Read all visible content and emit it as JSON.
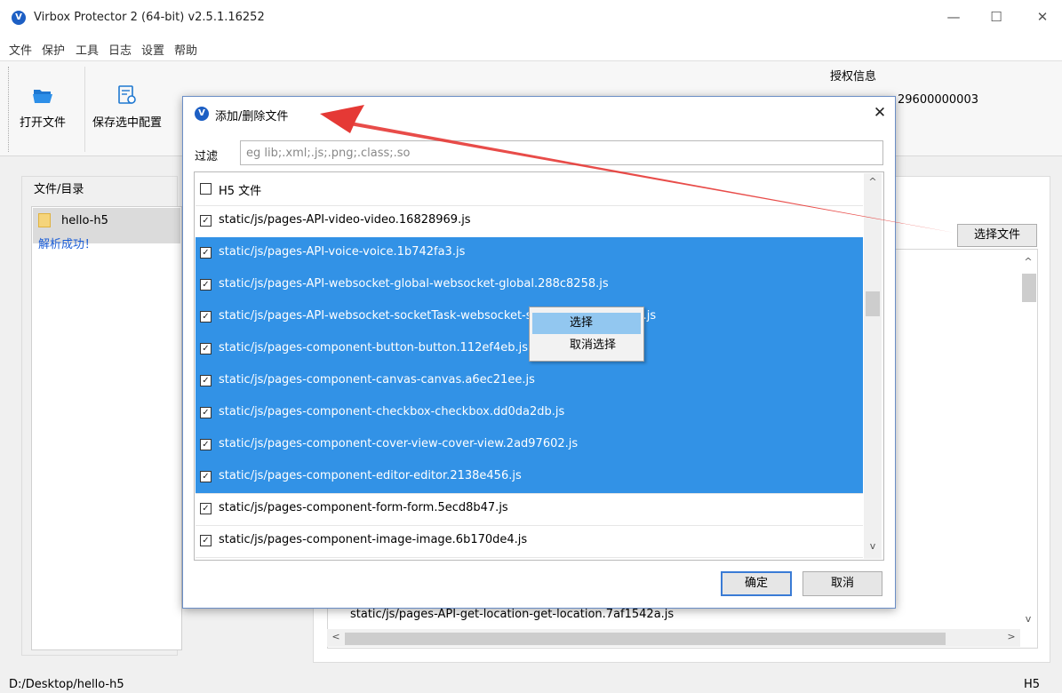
{
  "window": {
    "logo": "V",
    "title": "Virbox Protector 2 (64-bit) v2.5.1.16252",
    "minimize": "—",
    "maximize": "☐",
    "close": "✕"
  },
  "menu": [
    "文件",
    "保护",
    "工具",
    "日志",
    "设置",
    "帮助"
  ],
  "toolbar": {
    "open_file": "打开文件",
    "save_config": "保存选中配置"
  },
  "auth": {
    "title": "授权信息",
    "value": "29600000003"
  },
  "left_panel": {
    "legend": "文件/目录",
    "item_name": "hello-h5",
    "item_status": "解析成功！"
  },
  "right_panel": {
    "choose_file": "选择文件",
    "list_item": "static/js/pages-API-get-location-get-location.7af1542a.js",
    "scroll_up": "^",
    "scroll_down": "v",
    "scroll_left": "<",
    "scroll_right": ">"
  },
  "status": {
    "path": "D:/Desktop/hello-h5",
    "type": "H5"
  },
  "dialog": {
    "logo": "V",
    "title": "添加/删除文件",
    "close": "✕",
    "filter_label": "过滤",
    "filter_value": "",
    "filter_placeholder": "eg lib;.xml;.js;.png;.class;.so",
    "rows": [
      {
        "label": "H5 文件",
        "checked": false,
        "selected": false
      },
      {
        "label": "static/js/pages-API-video-video.16828969.js",
        "checked": true,
        "selected": false
      },
      {
        "label": "static/js/pages-API-voice-voice.1b742fa3.js",
        "checked": true,
        "selected": true
      },
      {
        "label": "static/js/pages-API-websocket-global-websocket-global.288c8258.js",
        "checked": true,
        "selected": true
      },
      {
        "label": "static/js/pages-API-websocket-socketTask-websocket-socketTask.99940e6.js",
        "checked": true,
        "selected": true
      },
      {
        "label": "static/js/pages-component-button-button.112ef4eb.js",
        "checked": true,
        "selected": true
      },
      {
        "label": "static/js/pages-component-canvas-canvas.a6ec21ee.js",
        "checked": true,
        "selected": true
      },
      {
        "label": "static/js/pages-component-checkbox-checkbox.dd0da2db.js",
        "checked": true,
        "selected": true
      },
      {
        "label": "static/js/pages-component-cover-view-cover-view.2ad97602.js",
        "checked": true,
        "selected": true
      },
      {
        "label": "static/js/pages-component-editor-editor.2138e456.js",
        "checked": true,
        "selected": true
      },
      {
        "label": "static/js/pages-component-form-form.5ecd8b47.js",
        "checked": true,
        "selected": false
      },
      {
        "label": "static/js/pages-component-image-image.6b170de4.js",
        "checked": true,
        "selected": false
      },
      {
        "label": "",
        "checked": false,
        "selected": false
      }
    ],
    "ok": "确定",
    "cancel": "取消",
    "scroll_up": "^",
    "scroll_down": "v"
  },
  "context_menu": {
    "select": "选择",
    "deselect": "取消选择"
  },
  "colors": {
    "selection": "#3292e6",
    "context_hover": "#92c7f0",
    "annotation_arrow": "#e53935",
    "link_status": "#1a5cd6"
  }
}
